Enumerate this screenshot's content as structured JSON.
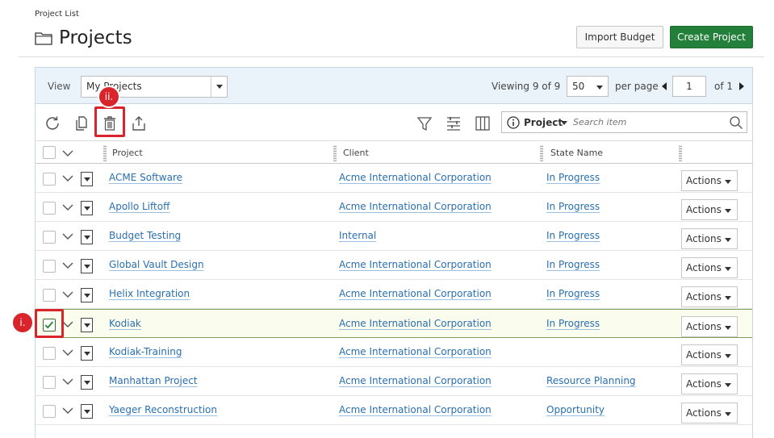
{
  "breadcrumb": "Project List",
  "page_title": "Projects",
  "header_buttons": {
    "import_budget": "Import Budget",
    "create_project": "Create Project"
  },
  "view": {
    "label": "View",
    "selected": "My Projects"
  },
  "pagination": {
    "viewing": "Viewing 9 of 9",
    "per_page_value": "50",
    "per_page_label": "per page",
    "page": "1",
    "of_total": "of 1"
  },
  "search": {
    "scope": "Project",
    "placeholder": "Search item"
  },
  "columns": {
    "project": "Project",
    "client": "Client",
    "state": "State Name"
  },
  "rows": [
    {
      "project": "ACME Software",
      "client": "Acme International Corporation",
      "state": "In Progress",
      "checked": false
    },
    {
      "project": "Apollo Liftoff",
      "client": "Acme International Corporation",
      "state": "In Progress",
      "checked": false
    },
    {
      "project": "Budget Testing",
      "client": "Internal",
      "state": "In Progress",
      "checked": false
    },
    {
      "project": "Global Vault Design",
      "client": "Acme International Corporation",
      "state": "In Progress",
      "checked": false
    },
    {
      "project": "Helix Integration",
      "client": "Acme International Corporation",
      "state": "In Progress",
      "checked": false
    },
    {
      "project": "Kodiak",
      "client": "Acme International Corporation",
      "state": "In Progress",
      "checked": true
    },
    {
      "project": "Kodiak-Training",
      "client": "Acme International Corporation",
      "state": "",
      "checked": false
    },
    {
      "project": "Manhattan Project",
      "client": "Acme International Corporation",
      "state": "Resource Planning",
      "checked": false
    },
    {
      "project": "Yaeger Reconstruction",
      "client": "Acme International Corporation",
      "state": "Opportunity",
      "checked": false
    }
  ],
  "actions_label": "Actions",
  "callouts": {
    "first": "i.",
    "second": "ii."
  },
  "icons": [
    "folder-icon",
    "refresh-icon",
    "copy-icon",
    "delete-icon",
    "export-icon",
    "filter-icon",
    "column-settings-icon",
    "columns-icon",
    "info-icon",
    "search-icon"
  ],
  "colors": {
    "create_button": "#23803a",
    "link": "#2a6fb0",
    "callout": "#d9242b",
    "viewbar": "#eaf3fa"
  }
}
